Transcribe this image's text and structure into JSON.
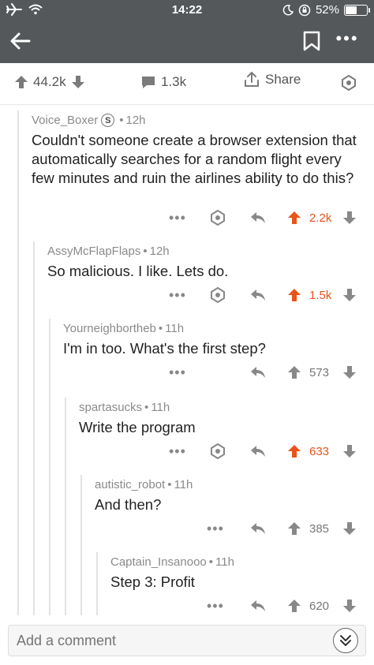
{
  "status_bar": {
    "time": "14:22",
    "battery": "52%"
  },
  "post": {
    "upvotes": "44.2k",
    "comments": "1.3k",
    "share_label": "Share"
  },
  "comments": [
    {
      "author": "Voice_Boxer",
      "flair": "S",
      "time": "12h",
      "body": "Couldn't someone create a browser extension that automatically searches for a random flight every few minutes and ruin the airlines ability to do this?",
      "score": "2.2k",
      "upvoted": true
    },
    {
      "author": "AssyMcFlapFlaps",
      "time": "12h",
      "body": "So malicious. I like. Lets do.",
      "score": "1.5k",
      "upvoted": true
    },
    {
      "author": "Yourneighbortheb",
      "time": "11h",
      "body": "I'm in too. What's the first step?",
      "score": "573",
      "upvoted": false
    },
    {
      "author": "spartasucks",
      "time": "11h",
      "body": "Write the program",
      "score": "633",
      "upvoted": true
    },
    {
      "author": "autistic_robot",
      "time": "11h",
      "body": "And then?",
      "score": "385",
      "upvoted": false
    },
    {
      "author": "Captain_Insanooo",
      "time": "11h",
      "body": "Step 3: Profit",
      "score": "620",
      "upvoted": false
    }
  ],
  "comment_input": {
    "placeholder": "Add a comment"
  },
  "colors": {
    "header": "#55585b",
    "upvote": "#e8541b",
    "muted": "#888888"
  },
  "icons": [
    "airplane-icon",
    "wifi-icon",
    "moon-icon",
    "rotation-lock-icon",
    "battery-icon",
    "back-arrow-icon",
    "bookmark-icon",
    "more-icon",
    "upvote-icon",
    "downvote-icon",
    "comment-icon",
    "share-icon",
    "award-icon",
    "reply-icon",
    "chevron-double-down-icon"
  ]
}
